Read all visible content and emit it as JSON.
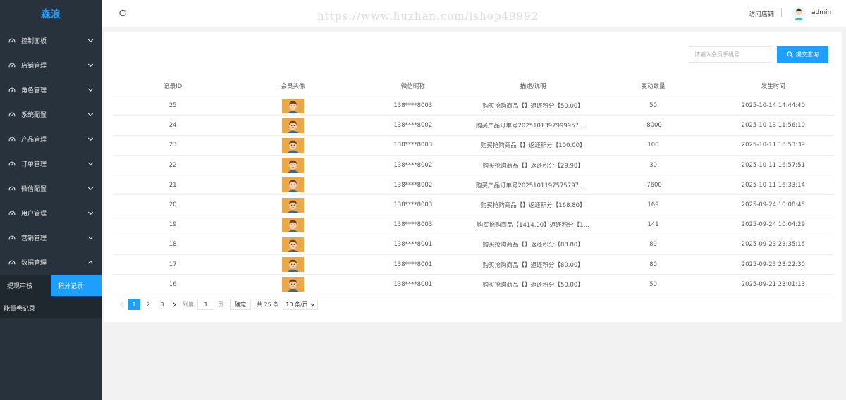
{
  "sidebar": {
    "brand": "森浪",
    "items": [
      {
        "label": "控制面板"
      },
      {
        "label": "店铺管理"
      },
      {
        "label": "角色管理"
      },
      {
        "label": "系统配置"
      },
      {
        "label": "产品管理"
      },
      {
        "label": "订单管理"
      },
      {
        "label": "微信配置"
      },
      {
        "label": "用户管理"
      },
      {
        "label": "营销管理"
      },
      {
        "label": "数据管理"
      }
    ],
    "sub_items": [
      {
        "label": "提现审核"
      },
      {
        "label": "积分记录"
      },
      {
        "label": "能量卷记录"
      }
    ],
    "active_sub": "积分记录"
  },
  "header": {
    "watermark": "https://www.huzhan.com/ishop49992",
    "visit_store": "访问店铺",
    "username": "admin"
  },
  "search": {
    "placeholder": "请输入会员手机号",
    "button_label": "提交查询"
  },
  "table": {
    "columns": [
      "记录ID",
      "会员头像",
      "微信昵称",
      "描述/说明",
      "变动数量",
      "发生时间"
    ],
    "rows": [
      {
        "id": "25",
        "nickname": "138****8003",
        "desc": "购买抢购商品【】返还积分【50.00】",
        "change": "50",
        "time": "2025-10-14 14:44:40"
      },
      {
        "id": "24",
        "nickname": "138****8002",
        "desc": "购买产品订单号2025101397999957消...",
        "change": "-8000",
        "time": "2025-10-13 11:56:10"
      },
      {
        "id": "23",
        "nickname": "138****8003",
        "desc": "购买抢购商品【】返还积分【100.00】",
        "change": "100",
        "time": "2025-10-11 18:53:39"
      },
      {
        "id": "22",
        "nickname": "138****8002",
        "desc": "购买抢购商品【】返还积分【29.90】",
        "change": "30",
        "time": "2025-10-11 16:57:51"
      },
      {
        "id": "21",
        "nickname": "138****8002",
        "desc": "购买产品订单号2025101197575797消...",
        "change": "-7600",
        "time": "2025-10-11 16:33:14"
      },
      {
        "id": "20",
        "nickname": "138****8003",
        "desc": "购买抢购商品【】返还积分【168.80】",
        "change": "169",
        "time": "2025-09-24 10:08:45"
      },
      {
        "id": "19",
        "nickname": "138****8003",
        "desc": "购买抢购商品【1414.00】返还积分【1...",
        "change": "141",
        "time": "2025-09-24 10:04:29"
      },
      {
        "id": "18",
        "nickname": "138****8001",
        "desc": "购买抢购商品【】返还积分【88.80】",
        "change": "89",
        "time": "2025-09-23 23:35:15"
      },
      {
        "id": "17",
        "nickname": "138****8001",
        "desc": "购买抢购商品【】返还积分【80.00】",
        "change": "80",
        "time": "2025-09-23 23:22:30"
      },
      {
        "id": "16",
        "nickname": "138****8001",
        "desc": "购买抢购商品【】返还积分【50.00】",
        "change": "50",
        "time": "2025-09-21 23:01:13"
      }
    ]
  },
  "pagination": {
    "pages": [
      "1",
      "2",
      "3"
    ],
    "current": "1",
    "goto_label": "到第",
    "goto_value": "1",
    "page_unit": "页",
    "confirm_label": "确定",
    "total_label": "共 25 条",
    "page_size": "10 条/页"
  },
  "colors": {
    "sidebar_bg": "#28323c",
    "accent": "#1e9fff",
    "avatar_bg": "#e9a94a"
  }
}
